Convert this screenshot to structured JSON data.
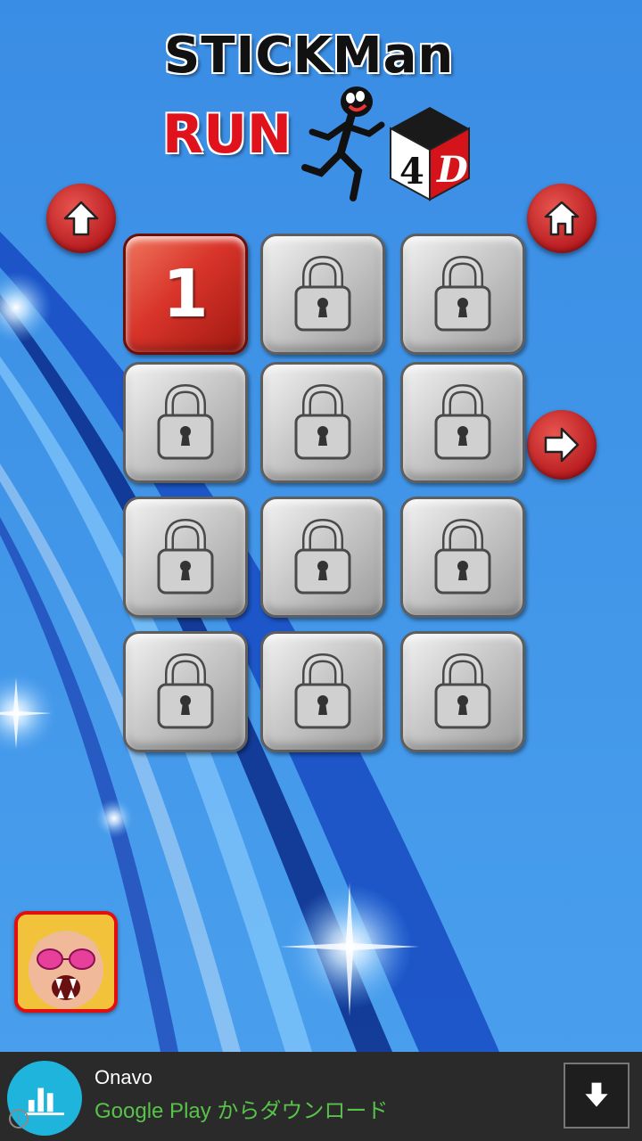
{
  "title": {
    "line1": "STICKMan",
    "line2": "RUN",
    "cube_label": "4D"
  },
  "nav": {
    "up_icon": "arrow-up-icon",
    "home_icon": "home-icon",
    "next_icon": "arrow-right-icon"
  },
  "levels": [
    {
      "label": "1",
      "locked": false
    },
    {
      "label": "",
      "locked": true
    },
    {
      "label": "",
      "locked": true
    },
    {
      "label": "",
      "locked": true
    },
    {
      "label": "",
      "locked": true
    },
    {
      "label": "",
      "locked": true
    },
    {
      "label": "",
      "locked": true
    },
    {
      "label": "",
      "locked": true
    },
    {
      "label": "",
      "locked": true
    },
    {
      "label": "",
      "locked": true
    },
    {
      "label": "",
      "locked": true
    },
    {
      "label": "",
      "locked": true
    }
  ],
  "ad": {
    "title": "Onavo",
    "subtitle": "Google Play からダウンロード",
    "info": "i"
  },
  "colors": {
    "background": "#3d8fe0",
    "active_tile": "#d8342a",
    "nav_button": "#b81c20",
    "ad_subtitle": "#58c24a"
  }
}
